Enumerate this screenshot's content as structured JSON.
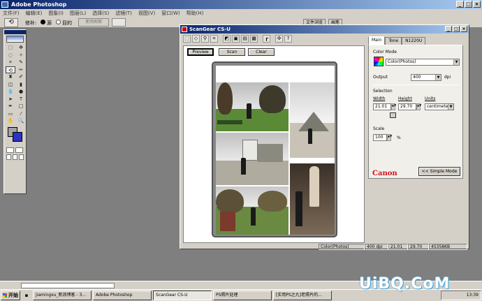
{
  "photoshop": {
    "title": "Adobe Photoshop",
    "menus": [
      "文件(F)",
      "编辑(E)",
      "图象(I)",
      "图层(L)",
      "选择(S)",
      "滤镜(T)",
      "视图(V)",
      "窗口(W)",
      "帮助(H)"
    ],
    "options": {
      "feather_label": "修补:",
      "source_label": "源",
      "dest_label": "目的",
      "use_pattern_label": "使用图案"
    },
    "palette_tabs": [
      "文件浏览",
      "画笔"
    ]
  },
  "scangear": {
    "title": "ScanGear CS-U",
    "toolbar_icons": [
      "marquee-icon",
      "auto-crop-icon",
      "zoom-icon",
      "crop-icon",
      "multi-crop-icon",
      "preview-mode-icon",
      "thumbnail-icon",
      "select-all-icon",
      "settings-icon",
      "info-icon",
      "help-icon"
    ],
    "buttons": {
      "preview": "Preview",
      "scan": "Scan",
      "clear": "Clear"
    },
    "tabs": [
      "Main",
      "Tone",
      "N1220U"
    ],
    "color_mode_label": "Color Mode",
    "color_mode_value": "Color(Photos)",
    "output_label": "Output",
    "output_value": "400",
    "output_unit": "dpi",
    "selection_label": "Selection",
    "width_label": "Width",
    "width_value": "21.01",
    "height_label": "Height",
    "height_value": "29.70",
    "units_label": "Units",
    "units_value": "centimeter",
    "scale_label": "Scale",
    "scale_value": "100",
    "scale_unit": "%",
    "brand": "Canon",
    "simple_mode_label": "<< Simple Mode",
    "status": [
      "Color(Photos)",
      "400 dpi",
      "21.01",
      "29.70",
      "45358KB"
    ]
  },
  "taskbar": {
    "start": "开始",
    "tasks": [
      "jiamingxu_新浪博客 - 3...",
      "Adobe Photoshop",
      "ScanGear CS-U",
      "PS照片处理",
      "[实用PS之九]老照片的..."
    ],
    "clock": "13:39"
  },
  "watermark": "UiBQ.CoM"
}
